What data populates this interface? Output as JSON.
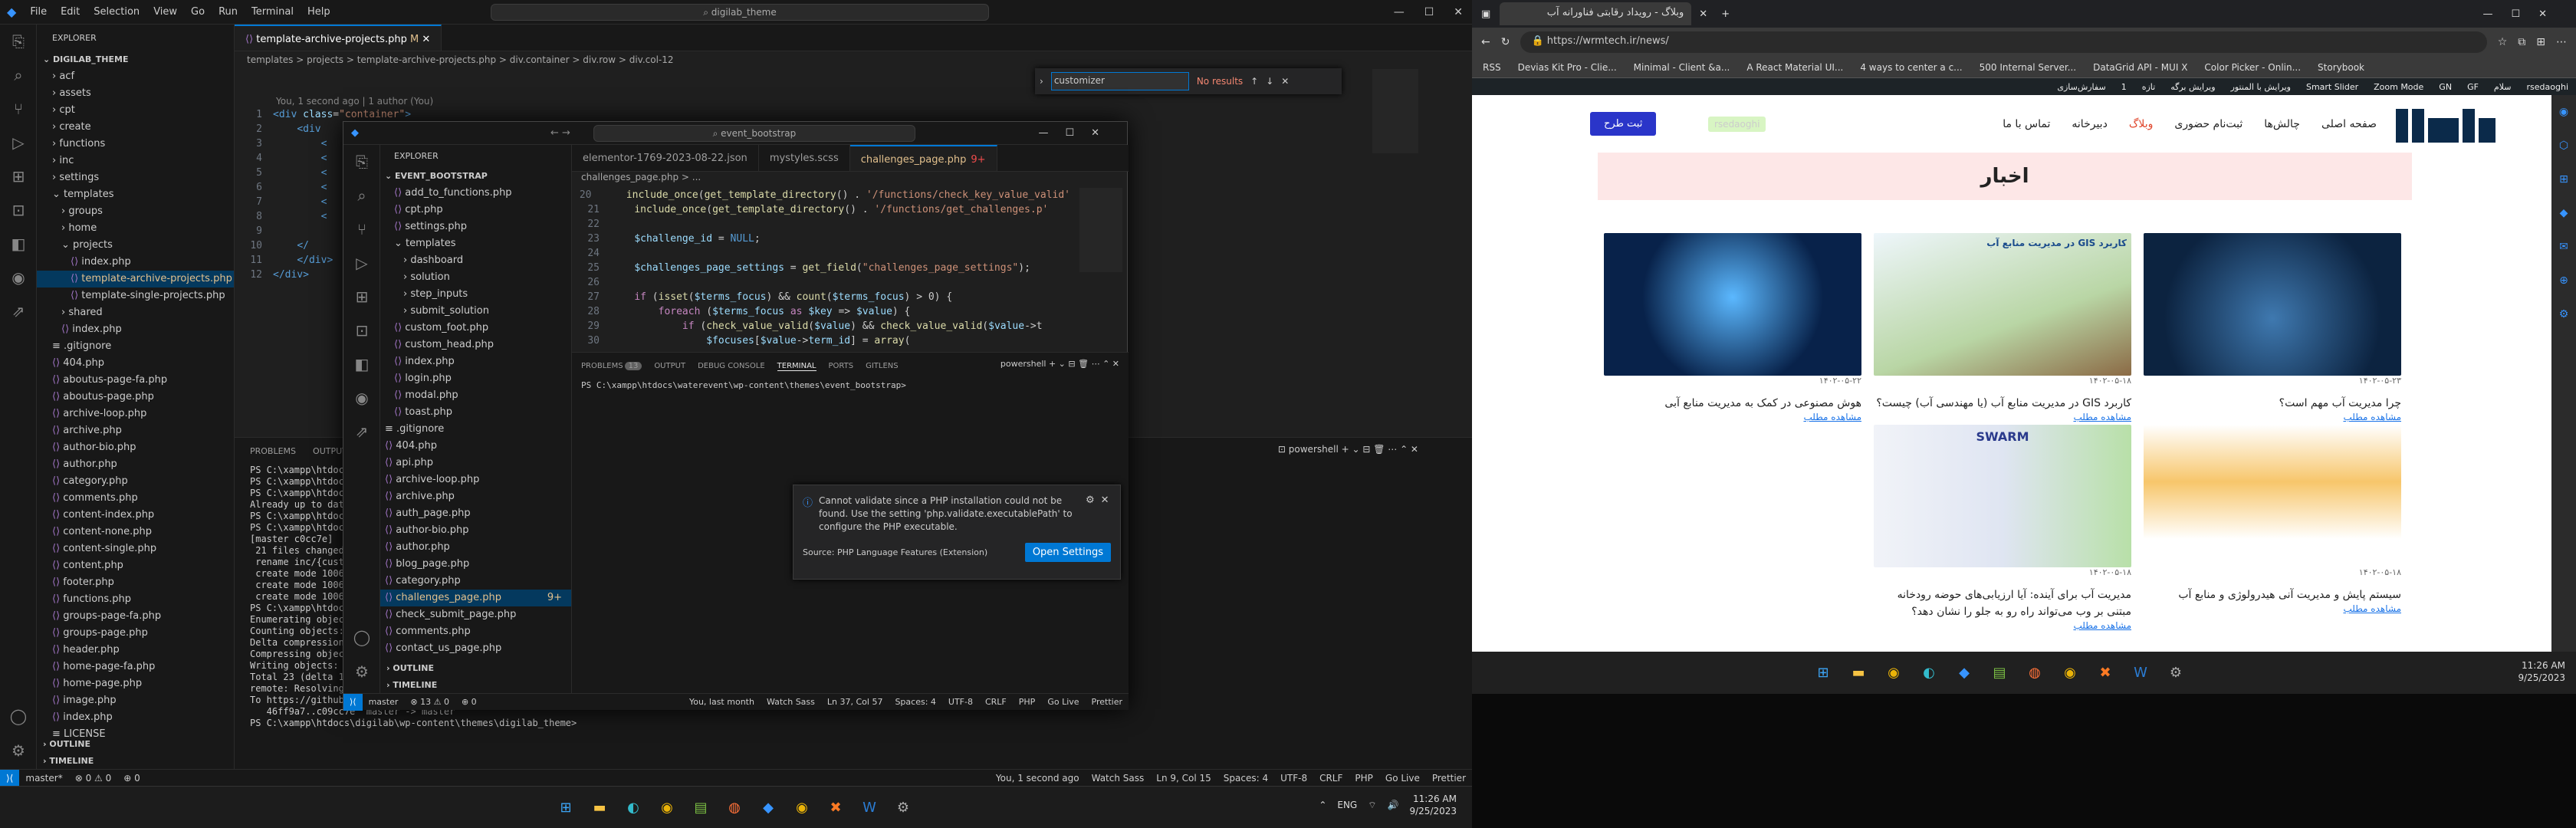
{
  "vs1": {
    "menu": [
      "File",
      "Edit",
      "Selection",
      "View",
      "Go",
      "Run",
      "Terminal",
      "Help"
    ],
    "search": "digilab_theme",
    "explorer_title": "EXPLORER",
    "root": "DIGILAB_THEME",
    "tree": [
      {
        "t": "acf",
        "k": "folder",
        "d": 1
      },
      {
        "t": "assets",
        "k": "folder",
        "d": 1
      },
      {
        "t": "cpt",
        "k": "folder",
        "d": 1
      },
      {
        "t": "create",
        "k": "folder",
        "d": 1
      },
      {
        "t": "functions",
        "k": "folder",
        "d": 1
      },
      {
        "t": "inc",
        "k": "folder",
        "d": 1
      },
      {
        "t": "settings",
        "k": "folder",
        "d": 1
      },
      {
        "t": "templates",
        "k": "folder-open",
        "d": 1
      },
      {
        "t": "groups",
        "k": "folder",
        "d": 2
      },
      {
        "t": "home",
        "k": "folder",
        "d": 2
      },
      {
        "t": "projects",
        "k": "folder-open",
        "d": 2
      },
      {
        "t": "index.php",
        "k": "php",
        "d": 3
      },
      {
        "t": "template-archive-projects.php",
        "k": "php",
        "d": 3,
        "sel": true,
        "badge": "M"
      },
      {
        "t": "template-single-projects.php",
        "k": "php",
        "d": 3
      },
      {
        "t": "shared",
        "k": "folder",
        "d": 2
      },
      {
        "t": "index.php",
        "k": "php",
        "d": 2
      },
      {
        "t": ".gitignore",
        "k": "file",
        "d": 1
      },
      {
        "t": "404.php",
        "k": "php",
        "d": 1
      },
      {
        "t": "aboutus-page-fa.php",
        "k": "php",
        "d": 1
      },
      {
        "t": "aboutus-page.php",
        "k": "php",
        "d": 1
      },
      {
        "t": "archive-loop.php",
        "k": "php",
        "d": 1
      },
      {
        "t": "archive.php",
        "k": "php",
        "d": 1
      },
      {
        "t": "author-bio.php",
        "k": "php",
        "d": 1
      },
      {
        "t": "author.php",
        "k": "php",
        "d": 1
      },
      {
        "t": "category.php",
        "k": "php",
        "d": 1
      },
      {
        "t": "comments.php",
        "k": "php",
        "d": 1
      },
      {
        "t": "content-index.php",
        "k": "php",
        "d": 1
      },
      {
        "t": "content-none.php",
        "k": "php",
        "d": 1
      },
      {
        "t": "content-single.php",
        "k": "php",
        "d": 1
      },
      {
        "t": "content.php",
        "k": "php",
        "d": 1
      },
      {
        "t": "footer.php",
        "k": "php",
        "d": 1
      },
      {
        "t": "functions.php",
        "k": "php",
        "d": 1
      },
      {
        "t": "groups-page-fa.php",
        "k": "php",
        "d": 1
      },
      {
        "t": "groups-page.php",
        "k": "php",
        "d": 1
      },
      {
        "t": "header.php",
        "k": "php",
        "d": 1
      },
      {
        "t": "home-page-fa.php",
        "k": "php",
        "d": 1
      },
      {
        "t": "home-page.php",
        "k": "php",
        "d": 1
      },
      {
        "t": "image.php",
        "k": "php",
        "d": 1
      },
      {
        "t": "index.php",
        "k": "php",
        "d": 1
      },
      {
        "t": "LICENSE",
        "k": "file",
        "d": 1
      }
    ],
    "outline": "OUTLINE",
    "timeline": "TIMELINE",
    "tab": "template-archive-projects.php",
    "breadcrumb": "templates > projects > template-archive-projects.php > div.container > div.row > div.col-12",
    "find_value": "customizer",
    "find_result": "No results",
    "blame": "You, 1 second ago | 1 author (You)",
    "code": [
      {
        "n": "1",
        "h": "<span class='tag'>&lt;div</span> <span class='att'>class</span>=<span class='str'>\"container\"</span><span class='tag'>&gt;</span>"
      },
      {
        "n": "2",
        "h": "    <span class='tag'>&lt;div</span>"
      },
      {
        "n": "3",
        "h": "        <span class='tag'>&lt;</span>"
      },
      {
        "n": "4",
        "h": "        <span class='tag'>&lt;</span>"
      },
      {
        "n": "5",
        "h": "        <span class='tag'>&lt;</span>"
      },
      {
        "n": "6",
        "h": "        <span class='tag'>&lt;</span>"
      },
      {
        "n": "7",
        "h": "        <span class='tag'>&lt;</span>"
      },
      {
        "n": "8",
        "h": "        <span class='tag'>&lt;</span>"
      },
      {
        "n": "9",
        "h": ""
      },
      {
        "n": "10",
        "h": "    <span class='tag'>&lt;/</span>"
      },
      {
        "n": "11",
        "h": "    <span class='tag'>&lt;/div&gt;</span>"
      },
      {
        "n": "12",
        "h": "<span class='tag'>&lt;/div&gt;</span>"
      }
    ],
    "panel_tabs": [
      "PROBLEMS",
      "OUTPUT"
    ],
    "shell": "powershell",
    "term": "PS C:\\xampp\\htdoc\nPS C:\\xampp\\htdoc\nPS C:\\xampp\\htdoc\nAlready up to dat\nPS C:\\xampp\\htdoc\nPS C:\\xampp\\htdoc\n[master c0cc7e]\n 21 files changed\n rename inc/{cust\n create mode 1006\n create mode 1006\n create mode 1006\nPS C:\\xampp\\htdoc\nEnumerating objec\nCounting objects:\nDelta compression\nCompressing objec\nWriting objects: \nTotal 23 (delta 18), reused 0 (delta 0), pack-reused 0\nremote: Resolving deltas: 100% (18/18), completed with 6 local objects.\nTo https://github.com/r-sedaghi/digilab_theme.git\n   46ff9a7..c09cc7e  master -> master\nPS C:\\xampp\\htdocs\\digilab\\wp-content\\themes\\digilab_theme> ",
    "status": [
      "master*",
      "⊗ 0 ⚠ 0",
      "⊕ 0"
    ],
    "status_r": [
      "You, 1 second ago",
      "Watch Sass",
      "Ln 9, Col 15",
      "Spaces: 4",
      "UTF-8",
      "CRLF",
      "PHP",
      "Go Live",
      "Prettier"
    ],
    "tray": {
      "lang": "ENG",
      "time": "11:26 AM",
      "date": "9/25/2023"
    }
  },
  "vs2": {
    "search": "event_bootstrap",
    "explorer_title": "EXPLORER",
    "root": "EVENT_BOOTSTRAP",
    "tree": [
      {
        "t": "add_to_functions.php",
        "k": "php",
        "d": 1
      },
      {
        "t": "cpt.php",
        "k": "php",
        "d": 1
      },
      {
        "t": "settings.php",
        "k": "php",
        "d": 1
      },
      {
        "t": "templates",
        "k": "folder-open",
        "d": 1
      },
      {
        "t": "dashboard",
        "k": "folder",
        "d": 2
      },
      {
        "t": "solution",
        "k": "folder",
        "d": 2
      },
      {
        "t": "step_inputs",
        "k": "folder",
        "d": 2
      },
      {
        "t": "submit_solution",
        "k": "folder",
        "d": 2
      },
      {
        "t": "custom_foot.php",
        "k": "php",
        "d": 1
      },
      {
        "t": "custom_head.php",
        "k": "php",
        "d": 1
      },
      {
        "t": "index.php",
        "k": "php",
        "d": 1
      },
      {
        "t": "login.php",
        "k": "php",
        "d": 1
      },
      {
        "t": "modal.php",
        "k": "php",
        "d": 1
      },
      {
        "t": "toast.php",
        "k": "php",
        "d": 1
      },
      {
        "t": ".gitignore",
        "k": "file",
        "d": 0
      },
      {
        "t": "404.php",
        "k": "php",
        "d": 0
      },
      {
        "t": "api.php",
        "k": "php",
        "d": 0
      },
      {
        "t": "archive-loop.php",
        "k": "php",
        "d": 0
      },
      {
        "t": "archive.php",
        "k": "php",
        "d": 0
      },
      {
        "t": "auth_page.php",
        "k": "php",
        "d": 0
      },
      {
        "t": "author-bio.php",
        "k": "php",
        "d": 0
      },
      {
        "t": "author.php",
        "k": "php",
        "d": 0
      },
      {
        "t": "blog_page.php",
        "k": "php",
        "d": 0
      },
      {
        "t": "category.php",
        "k": "php",
        "d": 0
      },
      {
        "t": "challenges_page.php",
        "k": "php",
        "d": 0,
        "sel": true,
        "badge": "9+"
      },
      {
        "t": "check_submit_page.php",
        "k": "php",
        "d": 0
      },
      {
        "t": "comments.php",
        "k": "php",
        "d": 0
      },
      {
        "t": "contact_us_page.php",
        "k": "php",
        "d": 0
      }
    ],
    "outline": "OUTLINE",
    "timeline": "TIMELINE",
    "tabs": [
      {
        "t": "elementor-1769-2023-08-22.json",
        "a": false
      },
      {
        "t": "mystyles.scss",
        "a": false
      },
      {
        "t": "challenges_page.php",
        "a": true,
        "b": "9+"
      }
    ],
    "breadcrumb": "challenges_page.php > ...",
    "code": [
      {
        "n": "20",
        "h": "    <span class='fn'>include_once</span>(<span class='fn'>get_template_directory</span>() . <span class='str'>'/functions/check_key_value_valid'</span>"
      },
      {
        "n": "21",
        "h": "    <span class='fn'>include_once</span>(<span class='fn'>get_template_directory</span>() . <span class='str'>'/functions/get_challenges.p'</span>"
      },
      {
        "n": "22",
        "h": ""
      },
      {
        "n": "23",
        "h": "    <span class='var'>$challenge_id</span> = <span class='kw'>NULL</span>;"
      },
      {
        "n": "24",
        "h": ""
      },
      {
        "n": "25",
        "h": "    <span class='var'>$challenges_page_settings</span> = <span class='fn'>get_field</span>(<span class='str'>\"challenges_page_settings\"</span>);"
      },
      {
        "n": "26",
        "h": ""
      },
      {
        "n": "27",
        "h": "    <span class='ctl'>if</span> (<span class='fn'>isset</span>(<span class='var'>$terms_focus</span>) &amp;&amp; <span class='fn'>count</span>(<span class='var'>$terms_focus</span>) &gt; 0) {"
      },
      {
        "n": "28",
        "h": "        <span class='ctl'>foreach</span> (<span class='var'>$terms_focus</span> <span class='ctl'>as</span> <span class='var'>$key</span> =&gt; <span class='var'>$value</span>) {"
      },
      {
        "n": "29",
        "h": "            <span class='ctl'>if</span> (<span class='fn'>check_value_valid</span>(<span class='var'>$value</span>) &amp;&amp; <span class='fn'>check_value_valid</span>(<span class='var'>$value</span>-&gt;t"
      },
      {
        "n": "30",
        "h": "                <span class='var'>$focuses</span>[<span class='var'>$value</span>-&gt;<span class='var'>term_id</span>] = <span class='fn'>array</span>("
      }
    ],
    "panel_tabs": [
      "PROBLEMS",
      "OUTPUT",
      "DEBUG CONSOLE",
      "TERMINAL",
      "PORTS",
      "GITLENS"
    ],
    "problems": "13",
    "shell": "powershell",
    "term": "PS C:\\xampp\\htdocs\\waterevent\\wp-content\\themes\\event_bootstrap>",
    "notif": {
      "msg": "Cannot validate since a PHP installation could not be found. Use the setting 'php.validate.executablePath' to configure the PHP executable.",
      "source": "Source: PHP Language Features (Extension)",
      "button": "Open Settings"
    },
    "status": [
      "master",
      "⊗ 13 ⚠ 0",
      "⊕ 0"
    ],
    "status_r": [
      "You, last month",
      "Watch Sass",
      "Ln 37, Col 57",
      "Spaces: 4",
      "UTF-8",
      "CRLF",
      "PHP",
      "Go Live",
      "Prettier"
    ]
  },
  "browser": {
    "tab": "وبلاگ - رویداد رقابتی فناورانه آب",
    "url": "https://wrmtech.ir/news/",
    "bookmarks": [
      "RSS",
      "Devias Kit Pro - Clie...",
      "Minimal - Client &a...",
      "A React Material UI...",
      "4 ways to center a c...",
      "500 Internal Server...",
      "DataGrid API - MUI X",
      "Color Picker - Onlin...",
      "Storybook"
    ],
    "adminbar": [
      "rsedaoghi",
      "سلام",
      "GF",
      "GN",
      "Zoom Mode",
      "Smart Slider",
      "ویرایش با المنتور",
      "ویرایش برگه",
      "تازه",
      "1",
      "سفارش‌سازی"
    ],
    "nav": [
      "صفحه اصلی",
      "چالش‌ها",
      "ثبت‌نام حضوری",
      "وبلاگ",
      "دبیرخانه",
      "تماس با ما"
    ],
    "user": "rsedaoghi",
    "cta": "ثبت طرح",
    "heading": "اخبار",
    "cards": [
      {
        "title": "چرا مدیریت آب مهم است؟",
        "date": "۱۴۰۲-۰۵-۲۳",
        "more": "مشاهده مطلب"
      },
      {
        "title": "کاربرد GIS در مدیریت منابع آب (یا مهندسی آب) چیست؟",
        "date": "۱۴۰۲-۰۵-۱۸",
        "more": "مشاهده مطلب",
        "img_caption": "کاربرد GIS در مدیریت منابع آب"
      },
      {
        "title": "هوش مصنوعی در کمک به مدیریت منابع آبی",
        "date": "۱۴۰۲-۰۵-۲۲",
        "more": "مشاهده مطلب"
      },
      {
        "title": "سیستم پایش و مدیریت آنی هیدرولوژی و منابع آب",
        "date": "۱۴۰۲-۰۵-۱۸",
        "more": "مشاهده مطلب"
      },
      {
        "title": "مدیریت آب برای آینده: آیا ارزیابی‌های حوضه رودخانه مبتنی بر وب می‌تواند راه رو به جلو را نشان دهد؟",
        "date": "۱۴۰۲-۰۵-۱۸",
        "more": "مشاهده مطلب",
        "img_caption": "SWARM"
      }
    ],
    "tray": {
      "time": "11:26 AM",
      "date": "9/25/2023"
    }
  }
}
